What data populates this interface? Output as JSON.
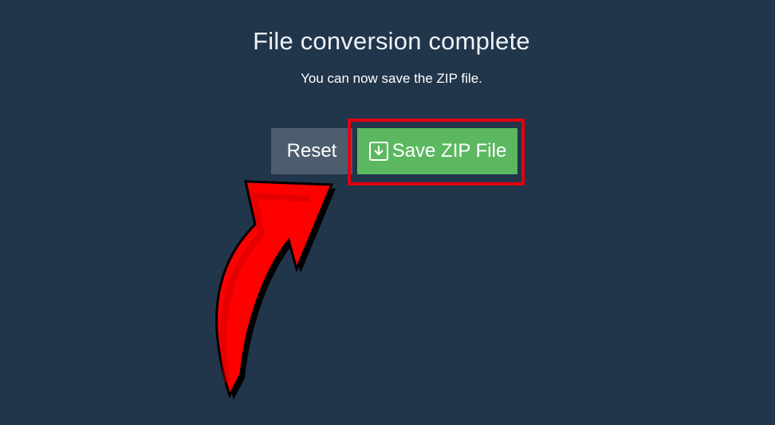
{
  "dialog": {
    "title": "File conversion complete",
    "subtitle": "You can now save the ZIP file."
  },
  "buttons": {
    "reset_label": "Reset",
    "save_label": "Save ZIP File",
    "save_icon": "download-icon"
  },
  "annotation": {
    "highlight_color": "#e3000f",
    "arrow_color": "#ff0000",
    "arrow_icon": "curved-arrow-icon"
  },
  "colors": {
    "background": "#21354b",
    "reset_button": "#4c5e6e",
    "save_button": "#5cb860"
  }
}
